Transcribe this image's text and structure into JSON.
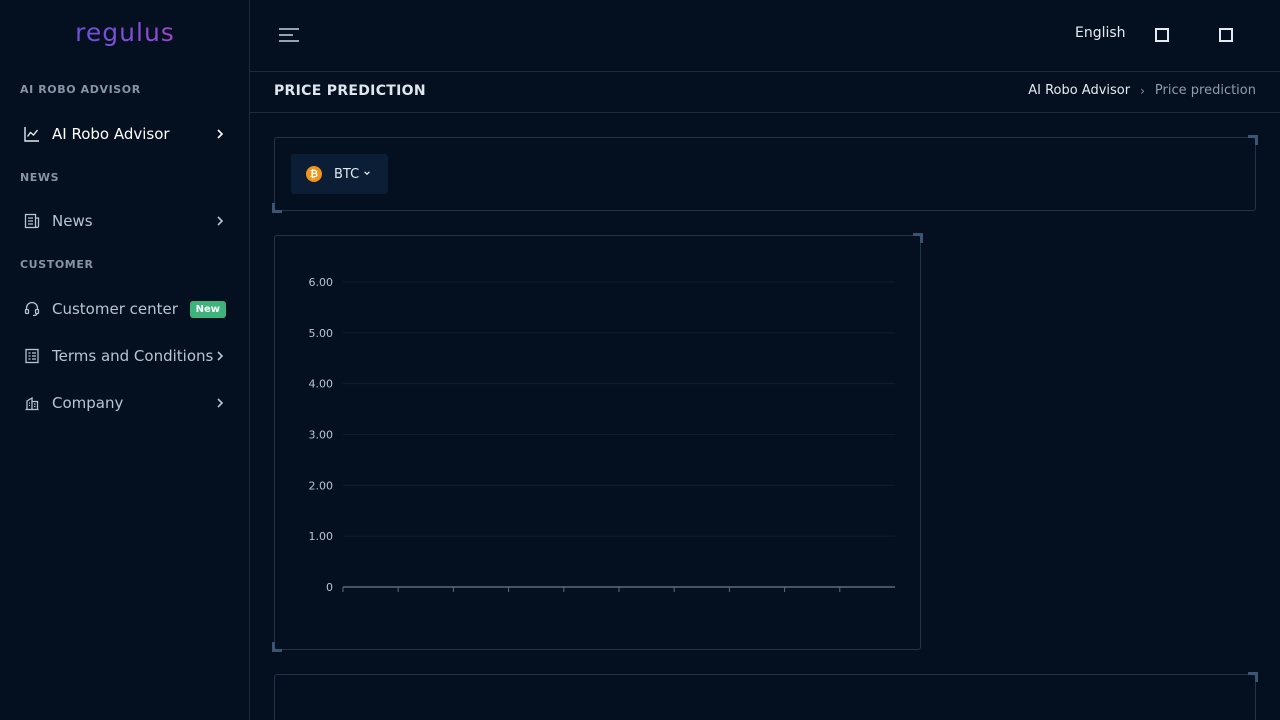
{
  "app": {
    "logo_text": "regulus"
  },
  "sidebar": {
    "sections": [
      {
        "title": "AI ROBO ADVISOR"
      },
      {
        "title": "NEWS"
      },
      {
        "title": "CUSTOMER"
      }
    ],
    "items": [
      {
        "label": "AI Robo Advisor",
        "icon": "chart-line-icon",
        "active": true
      },
      {
        "label": "News",
        "icon": "newspaper-icon"
      },
      {
        "label": "Customer center",
        "icon": "headset-icon",
        "badge": "New"
      },
      {
        "label": "Terms and Conditions",
        "icon": "document-list-icon"
      },
      {
        "label": "Company",
        "icon": "building-icon"
      }
    ]
  },
  "topbar": {
    "language": "English"
  },
  "header": {
    "title": "PRICE PREDICTION",
    "breadcrumb": [
      "AI Robo Advisor",
      "Price prediction"
    ]
  },
  "coin_selector": {
    "selected": "BTC",
    "coin_symbol": "₿"
  },
  "colors": {
    "accent_badge": "#3db47c",
    "coin": "#f2941a",
    "background": "#04101f"
  },
  "chart_data": {
    "type": "line",
    "title": "",
    "xlabel": "",
    "ylabel": "",
    "ylim": [
      0,
      6
    ],
    "y_ticks": [
      "0",
      "1.00",
      "2.00",
      "3.00",
      "4.00",
      "5.00",
      "6.00"
    ],
    "x_tick_count": 11,
    "series": [],
    "grid": true
  }
}
